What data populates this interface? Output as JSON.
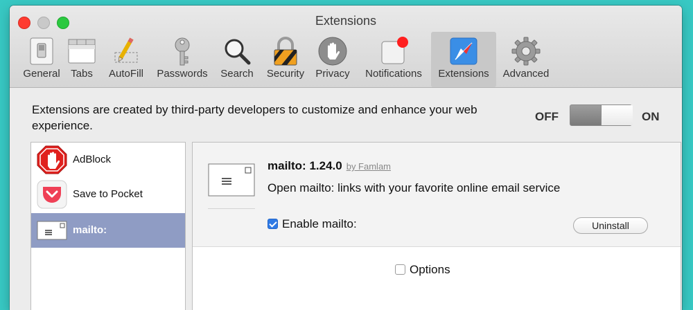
{
  "window": {
    "title": "Extensions"
  },
  "toolbar": {
    "items": [
      {
        "label": "General",
        "icon": "general-switch-icon"
      },
      {
        "label": "Tabs",
        "icon": "tabs-icon"
      },
      {
        "label": "AutoFill",
        "icon": "pencil-form-icon"
      },
      {
        "label": "Passwords",
        "icon": "key-icon"
      },
      {
        "label": "Search",
        "icon": "magnifier-icon"
      },
      {
        "label": "Security",
        "icon": "padlock-icon"
      },
      {
        "label": "Privacy",
        "icon": "hand-icon"
      },
      {
        "label": "Notifications",
        "icon": "notification-badge-icon"
      },
      {
        "label": "Extensions",
        "icon": "compass-icon",
        "selected": true
      },
      {
        "label": "Advanced",
        "icon": "gear-icon"
      }
    ]
  },
  "header": {
    "description": "Extensions are created by third-party developers to customize and enhance your web experience.",
    "off_label": "OFF",
    "on_label": "ON",
    "switch_state": "on"
  },
  "extensions": [
    {
      "name": "AdBlock",
      "icon": "adblock-hand-icon"
    },
    {
      "name": "Save to Pocket",
      "icon": "pocket-icon"
    },
    {
      "name": "mailto:",
      "icon": "envelope-icon",
      "selected": true
    }
  ],
  "detail": {
    "name": "mailto: 1.24.0",
    "by": "by Famlam",
    "description": "Open mailto: links with your favorite online email service",
    "enable_label": "Enable mailto:",
    "enable_checked": true,
    "uninstall_label": "Uninstall",
    "options_label": "Options",
    "options_checked": false
  },
  "colors": {
    "background": "#38c9c4",
    "selected_row": "#8f9cc4",
    "checkbox": "#2f7ae5",
    "close": "#ff3b30",
    "maximize": "#2bc940"
  }
}
